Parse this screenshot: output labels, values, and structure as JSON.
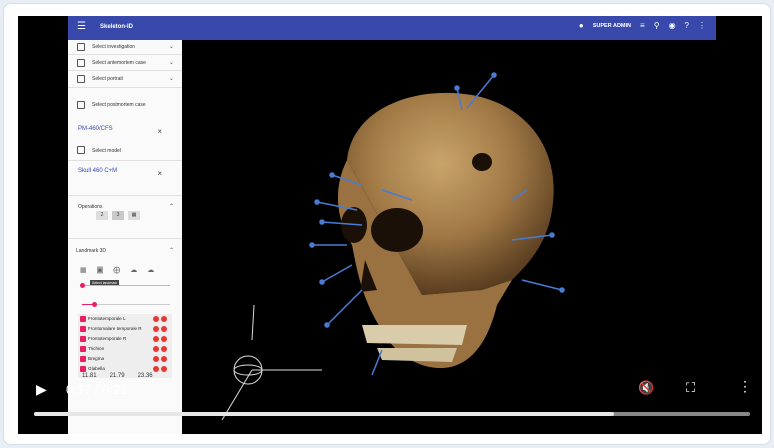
{
  "app": {
    "title": "Skeleton-ID",
    "user": "SUPER ADMIN"
  },
  "sidebar": {
    "select_investigation": "Select investigation",
    "select_antemortem": "Select antemortem case",
    "select_portrait": "Select portrait",
    "select_postmortem": "Select postmortem case",
    "postmortem_value": "PM-460/CFS",
    "select_model": "Select model",
    "model_value": "Skull 460 C+M",
    "operations": "Operations",
    "op_buttons": [
      "2",
      "3",
      ""
    ],
    "landmark_3d": "Landmark 3D",
    "tooltip": "Select landmark",
    "landmarks": [
      "Frontotemporale L",
      "Frontomalare temporale R",
      "Frontotemporale R",
      "Trichion",
      "Bregma",
      "Glabella"
    ],
    "coords": [
      "11.81",
      "21.79",
      "23.36"
    ]
  },
  "player": {
    "time": "0:17 / 0:21",
    "progress": 0.81
  },
  "colors": {
    "appbar": "#3949ab",
    "accent": "#e91e63",
    "landmark_vector": "#4a7bd4"
  }
}
